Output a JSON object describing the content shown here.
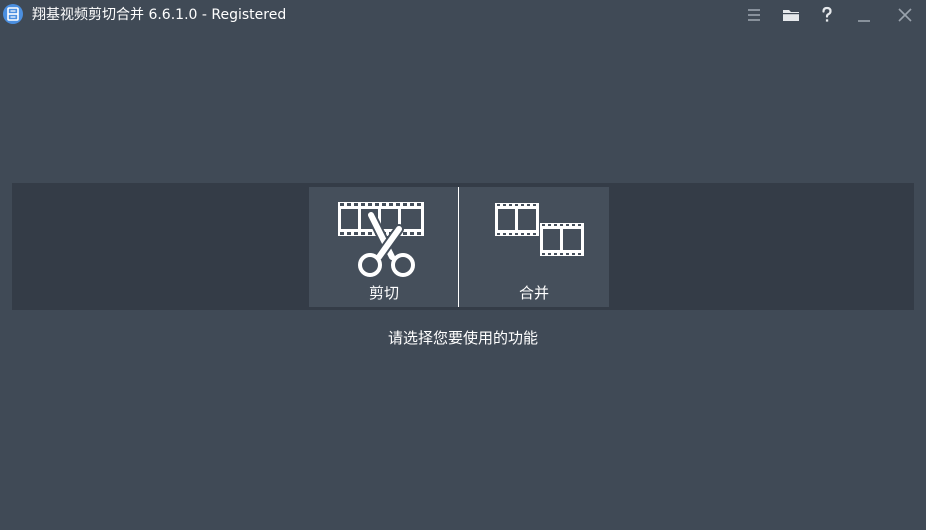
{
  "window": {
    "title": "翔基视频剪切合并 6.6.1.0 - Registered",
    "controls": [
      "menu-icon",
      "folder-icon",
      "help-icon",
      "minimize-icon",
      "close-icon"
    ]
  },
  "functions": [
    {
      "label": "剪切",
      "icon": "film-scissors-icon"
    },
    {
      "label": "合并",
      "icon": "film-merge-icon"
    }
  ],
  "hint": "请选择您要使用的功能",
  "colors": {
    "background": "#404a56",
    "band": "#343c47",
    "button": "#454f5b",
    "accent": "#4b8fe0",
    "text": "#ffffff"
  }
}
